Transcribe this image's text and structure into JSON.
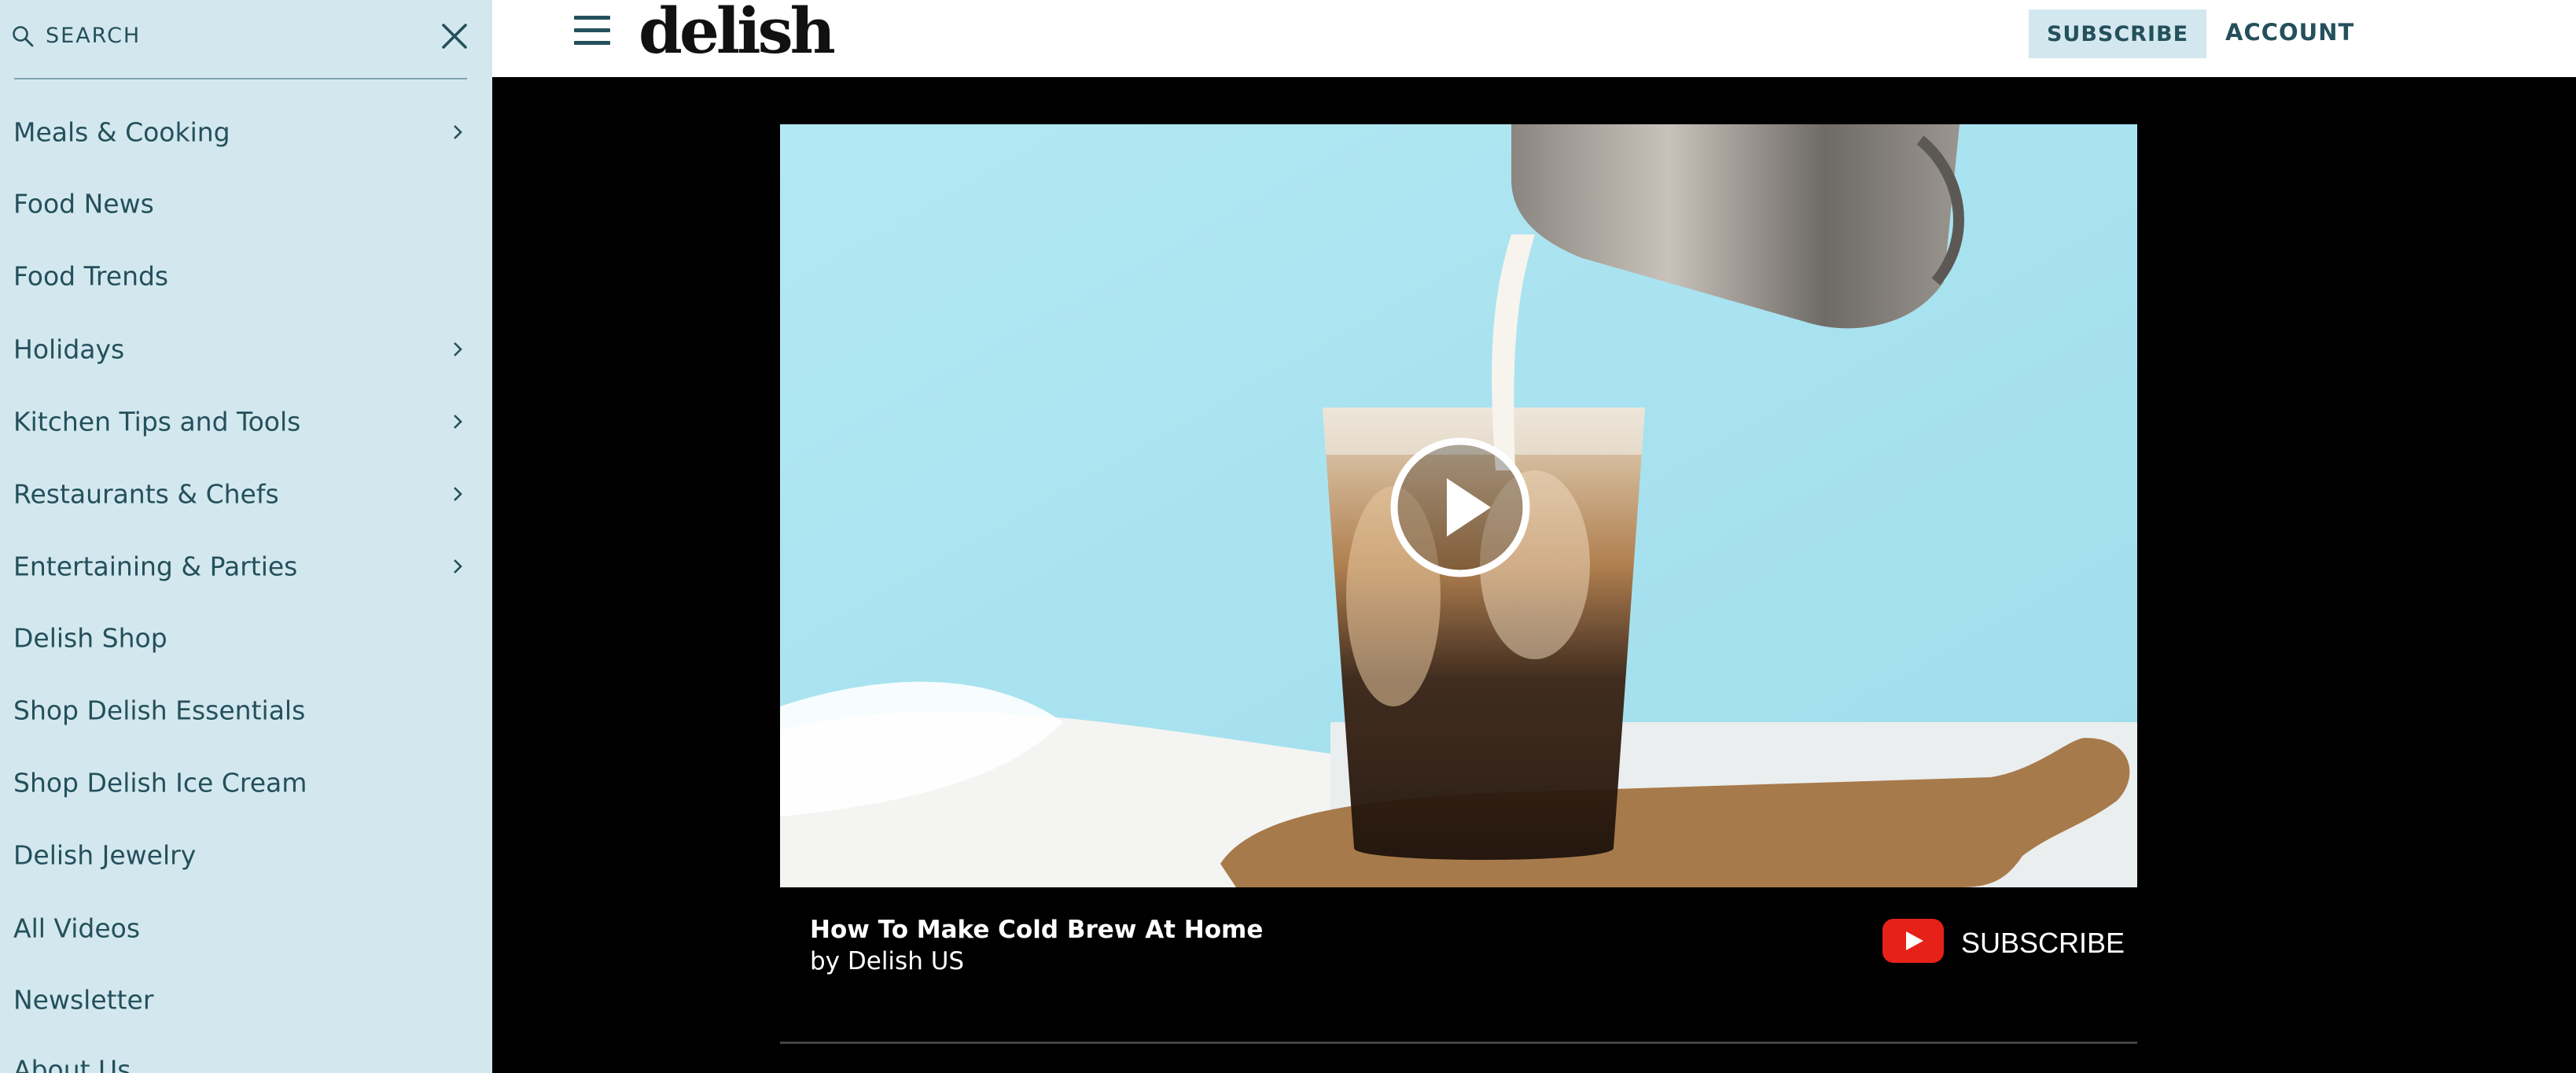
{
  "sidebar": {
    "search_label": "SEARCH",
    "items": [
      {
        "label": "Meals & Cooking",
        "has_submenu": true
      },
      {
        "label": "Food News",
        "has_submenu": false
      },
      {
        "label": "Food Trends",
        "has_submenu": false
      },
      {
        "label": "Holidays",
        "has_submenu": true
      },
      {
        "label": "Kitchen Tips and Tools",
        "has_submenu": true
      },
      {
        "label": "Restaurants & Chefs",
        "has_submenu": true
      },
      {
        "label": "Entertaining & Parties",
        "has_submenu": true
      },
      {
        "label": "Delish Shop",
        "has_submenu": false
      },
      {
        "label": "Shop Delish Essentials",
        "has_submenu": false
      },
      {
        "label": "Shop Delish Ice Cream",
        "has_submenu": false
      },
      {
        "label": "Delish Jewelry",
        "has_submenu": false
      },
      {
        "label": "All Videos",
        "has_submenu": false
      },
      {
        "label": "Newsletter",
        "has_submenu": false
      },
      {
        "label": "About Us",
        "has_submenu": false
      }
    ]
  },
  "header": {
    "logo": "delish",
    "subscribe_label": "SUBSCRIBE",
    "account_label": "ACCOUNT"
  },
  "video": {
    "title": "How To Make Cold Brew At Home",
    "author": "by Delish US",
    "youtube_subscribe_label": "SUBSCRIBE"
  },
  "colors": {
    "sidebar_bg": "#d3e8ee",
    "nav_text": "#24505c",
    "youtube_red": "#e62117",
    "video_sky": "#abe3ef"
  }
}
